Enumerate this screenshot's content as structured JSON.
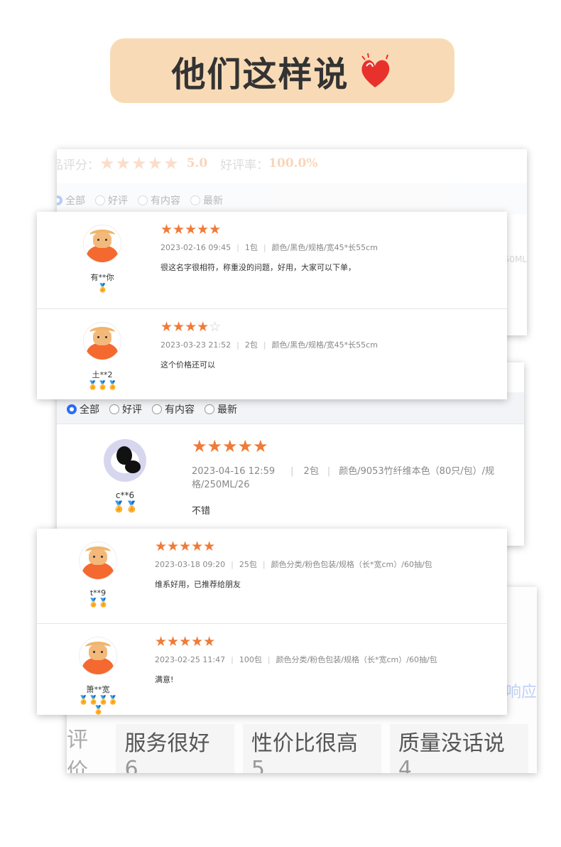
{
  "header": {
    "title": "他们这样说"
  },
  "background_card": {
    "rating_label": "品评分：",
    "score": "5.0",
    "good_rate_label": "好评率：",
    "good_rate": "100.0%",
    "filters": [
      "全部",
      "好评",
      "有内容",
      "最新"
    ],
    "right_spec_fragment": "50ML"
  },
  "card_top": {
    "reviews": [
      {
        "user": "有**你",
        "medals": 1,
        "stars": 5,
        "date": "2023-02-16 09:45",
        "qty": "1包",
        "spec": "颜色/黑色/规格/宽45*长55cm",
        "text": "很这名字很相符，称重没的问题，好用，大家可以下单，"
      },
      {
        "user": "土**2",
        "medals": 3,
        "stars": 4,
        "date": "2023-03-23 21:52",
        "qty": "2包",
        "spec": "颜色/黑色/规格/宽45*长55cm",
        "text": "这个价格还可以"
      }
    ]
  },
  "card_middle": {
    "filters": [
      "全部",
      "好评",
      "有内容",
      "最新"
    ],
    "review": {
      "user": "c**6",
      "medals": 2,
      "stars": 5,
      "date": "2023-04-16 12:59",
      "qty": "2包",
      "spec": "颜色/9053竹纤维本色（80只/包）/规格/250ML/26",
      "text": "不错"
    }
  },
  "card_bottom": {
    "reviews": [
      {
        "user": "t**9",
        "medals": 2,
        "stars": 5,
        "date": "2023-03-18 09:20",
        "qty": "25包",
        "spec": "颜色分类/粉色包装/规格（长*宽cm）/60抽/包",
        "text": "维系好用，已推荐给朋友"
      },
      {
        "user": "箫**宽",
        "medals": 5,
        "stars": 5,
        "date": "2023-02-25 11:47",
        "qty": "100包",
        "spec": "颜色分类/粉色包装/规格（长*宽cm）/60抽/包",
        "text": "满意!"
      }
    ]
  },
  "back_card": {
    "side_text": "响应",
    "label": "评价",
    "tags": [
      {
        "name": "服务很好",
        "count": "6"
      },
      {
        "name": "性价比很高",
        "count": "5"
      },
      {
        "name": "质量没话说",
        "count": "4"
      }
    ]
  },
  "colors": {
    "header_bg": "#f8dbb6",
    "star": "#ef7b38",
    "radio_on": "#2b6ef6"
  }
}
